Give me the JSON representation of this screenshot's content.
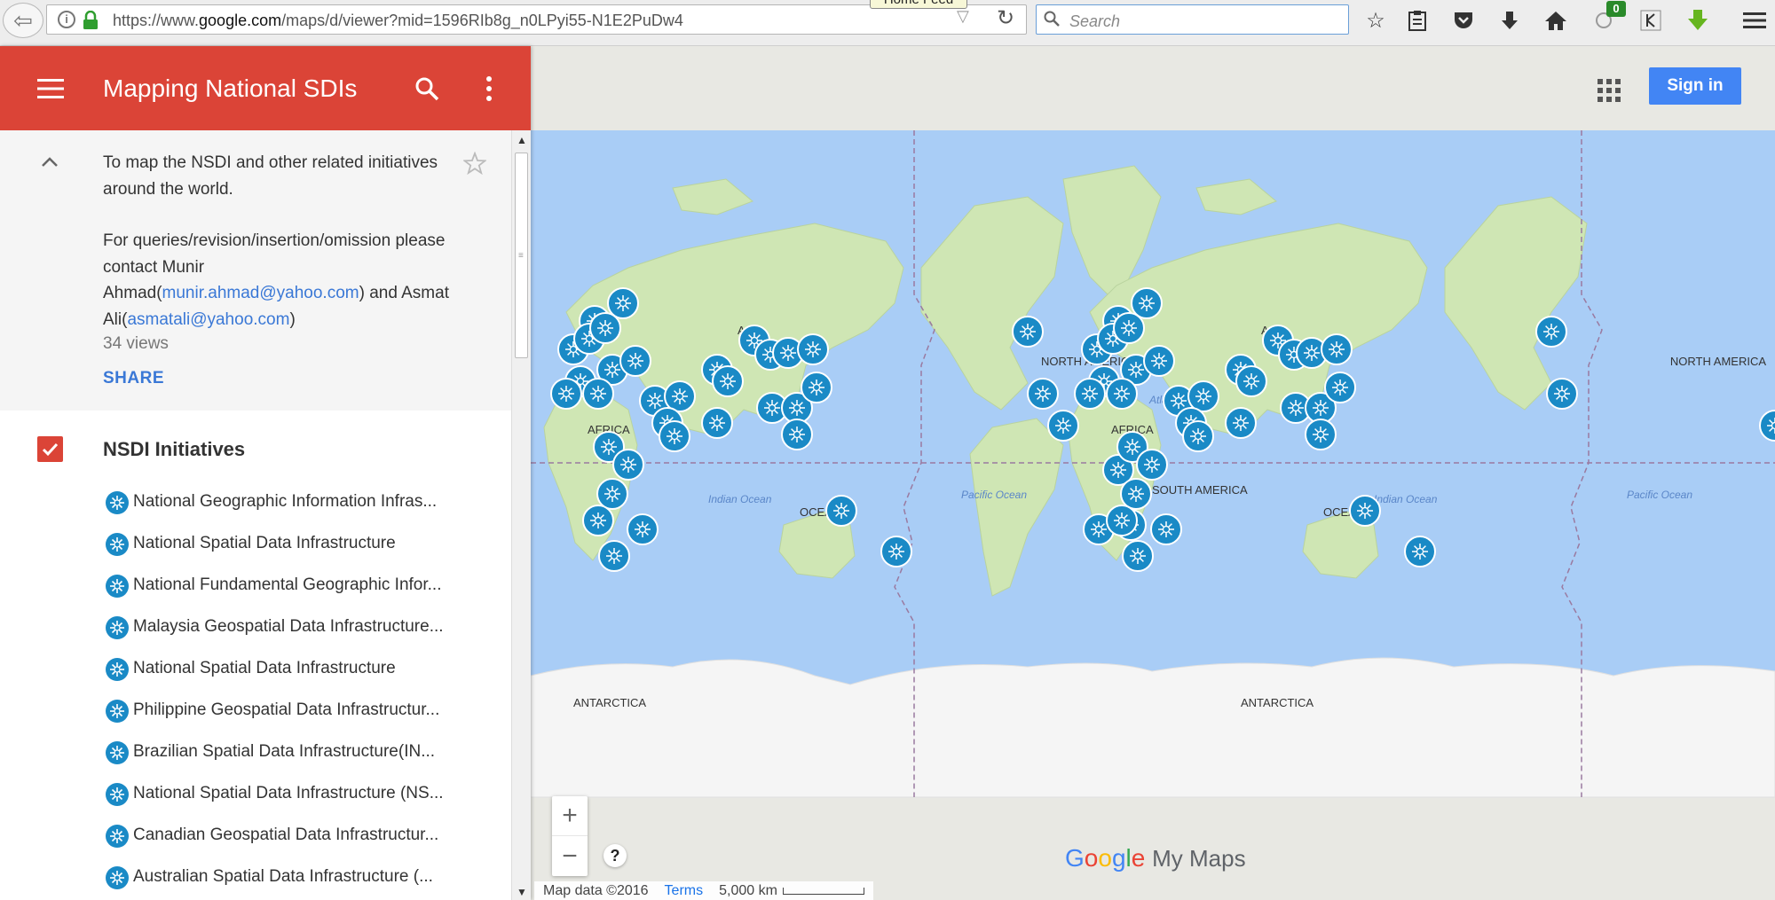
{
  "browser": {
    "url_prefix": "https://www.",
    "url_domain": "google.com",
    "url_path": "/maps/d/viewer?mid=1596RIb8g_n0LPyi55-N1E2PuDw4",
    "search_placeholder": "Search",
    "tooltip": "Home Feed",
    "badge_count": "0"
  },
  "panel": {
    "title": "Mapping National SDIs",
    "description_line1": "To map the NSDI and other related initiatives around the world.",
    "contact_prefix": "For queries/revision/insertion/omission please contact Munir Ahmad(",
    "contact_email1": "munir.ahmad@yahoo.com",
    "contact_mid": ") and Asmat Ali(",
    "contact_email2": "asmatali@yahoo.com",
    "contact_suffix": ")",
    "views": "34 views",
    "share": "SHARE",
    "layer_title": "NSDI Initiatives",
    "features": [
      "National Geographic Information Infras...",
      "National Spatial Data Infrastructure",
      "National Fundamental Geographic Infor...",
      "Malaysia Geospatial Data Infrastructure...",
      "National Spatial Data Infrastructure",
      "Philippine Geospatial Data Infrastructur...",
      "Brazilian Spatial Data Infrastructure(IN...",
      "National Spatial Data Infrastructure (NS...",
      "Canadian Geospatial Data Infrastructur...",
      "Australian Spatial Data Infrastructure (..."
    ]
  },
  "map": {
    "sign_in": "Sign in",
    "zoom_in": "+",
    "zoom_out": "−",
    "help": "?",
    "brand_my_maps": "My Maps",
    "attribution": "Map data ©2016",
    "terms": "Terms",
    "scale": "5,000 km",
    "labels": {
      "asia": "ASIA",
      "africa": "AFRICA",
      "north_america": "NORTH AMERICA",
      "south_america": "SOUTH AMERICA",
      "oceania": "OCEANIA",
      "antarctica": "ANTARCTICA",
      "atlantic_ocean": "Atlantic Ocean",
      "indian_ocean": "Indian Ocean",
      "pacific_ocean": "Pacific Ocean"
    },
    "colors": {
      "water": "#a9cdf6",
      "land": "#cfe6b4",
      "marker": "#1a8ac6",
      "header": "#db4437",
      "sign_in": "#4285f4"
    }
  }
}
